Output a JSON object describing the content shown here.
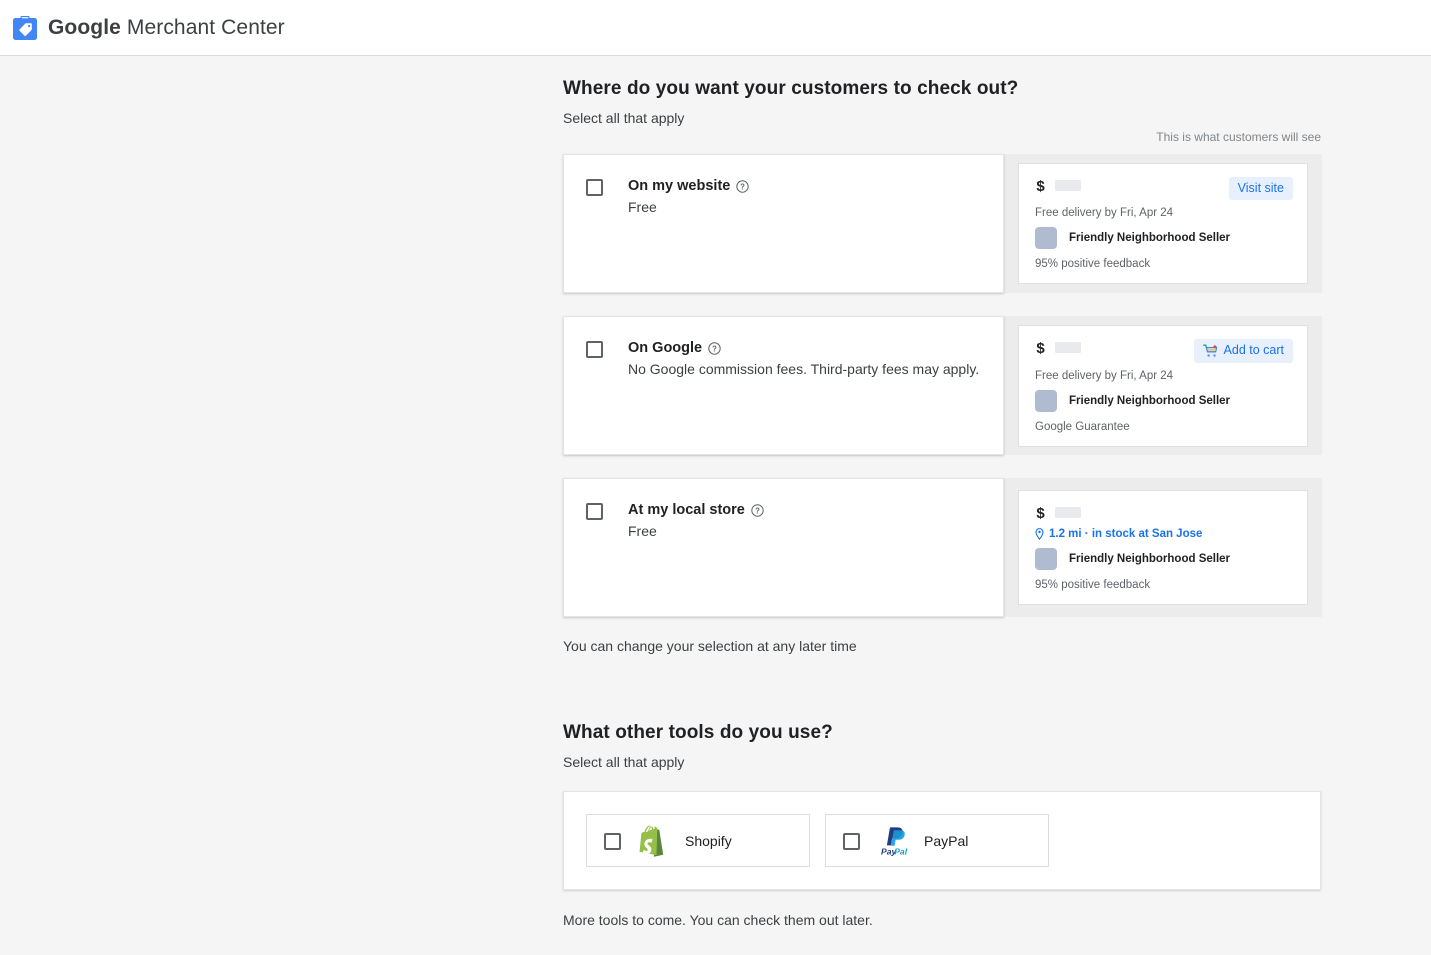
{
  "header": {
    "brand_strong": "Google",
    "brand_light": " Merchant Center",
    "logo_icon": "merchant-tag-icon"
  },
  "checkout_section": {
    "title": "Where do you want your customers to check out?",
    "subtitle": "Select all that apply",
    "preview_hint": "This is what customers will see",
    "note": "You can change your selection at any later time",
    "options": [
      {
        "name": "On my website",
        "description": "Free",
        "help_icon": "help-circle-icon",
        "checked": false,
        "preview": {
          "price_symbol": "$",
          "cta_label": "Visit site",
          "cta_icon": "",
          "sub": "Free delivery by Fri, Apr 24",
          "sub_is_location": false,
          "seller": "Friendly Neighborhood Seller",
          "footer": "95% positive feedback"
        }
      },
      {
        "name": "On Google",
        "description": "No Google commission fees. Third-party fees may apply.",
        "help_icon": "help-circle-icon",
        "checked": false,
        "preview": {
          "price_symbol": "$",
          "cta_label": "Add to cart",
          "cta_icon": "shopping-cart-icon",
          "sub": "Free delivery by Fri, Apr 24",
          "sub_is_location": false,
          "seller": "Friendly Neighborhood Seller",
          "footer": "Google Guarantee"
        }
      },
      {
        "name": "At my local store",
        "description": "Free",
        "help_icon": "help-circle-icon",
        "checked": false,
        "preview": {
          "price_symbol": "$",
          "cta_label": "",
          "cta_icon": "",
          "sub": "1.2 mi · in stock at San Jose",
          "sub_is_location": true,
          "seller": "Friendly Neighborhood Seller",
          "footer": "95% positive feedback"
        }
      }
    ]
  },
  "tools_section": {
    "title": "What other tools do you use?",
    "subtitle": "Select all that apply",
    "note": "More tools to come. You can check them out later.",
    "tools": [
      {
        "label": "Shopify",
        "logo_icon": "shopify-logo-icon",
        "checked": false
      },
      {
        "label": "PayPal",
        "logo_icon": "paypal-logo-icon",
        "checked": false
      }
    ]
  },
  "colors": {
    "accent_blue": "#1a73e8",
    "pill_bg": "#e8f0fe",
    "page_bg": "#f5f5f5",
    "panel_bg": "#ececec"
  }
}
